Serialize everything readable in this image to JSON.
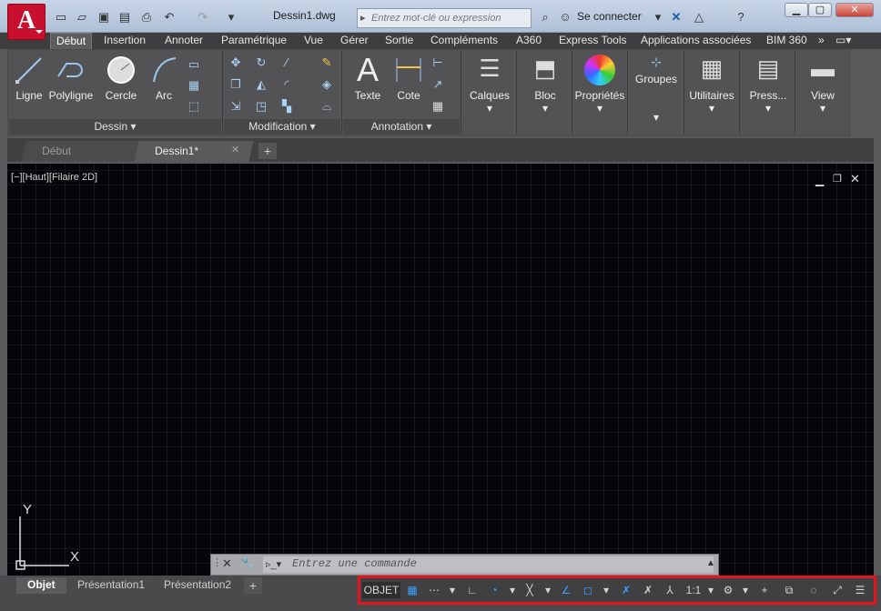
{
  "app": {
    "logo": "A",
    "document_title": "Dessin1.dwg"
  },
  "search": {
    "placeholder": "Entrez mot-clé ou expression"
  },
  "account": {
    "signin": "Se connecter"
  },
  "ribbon_tabs": [
    "Début",
    "Insertion",
    "Annoter",
    "Paramétrique",
    "Vue",
    "Gérer",
    "Sortie",
    "Compléments",
    "A360",
    "Express Tools",
    "Applications associées",
    "BIM 360"
  ],
  "panels": {
    "dessin": {
      "title": "Dessin",
      "tools": [
        "Ligne",
        "Polyligne",
        "Cercle",
        "Arc"
      ]
    },
    "modification": {
      "title": "Modification"
    },
    "annotation": {
      "title": "Annotation",
      "tools": [
        "Texte",
        "Cote"
      ]
    },
    "big_tools": [
      "Calques",
      "Bloc",
      "Propriétés",
      "Groupes",
      "Utilitaires",
      "Press...",
      "View"
    ]
  },
  "file_tabs": [
    "Début",
    "Dessin1*"
  ],
  "viewport": {
    "label": "[−][Haut][Filaire 2D]"
  },
  "ucs": {
    "x": "X",
    "y": "Y"
  },
  "command": {
    "placeholder": "Entrez une commande"
  },
  "layout_tabs": [
    "Objet",
    "Présentation1",
    "Présentation2"
  ],
  "status": {
    "model": "OBJET",
    "scale": "1:1"
  },
  "colors": {
    "accent": "#c8102e",
    "highlight": "#e8141b",
    "status_blue": "#3ca0ff"
  }
}
